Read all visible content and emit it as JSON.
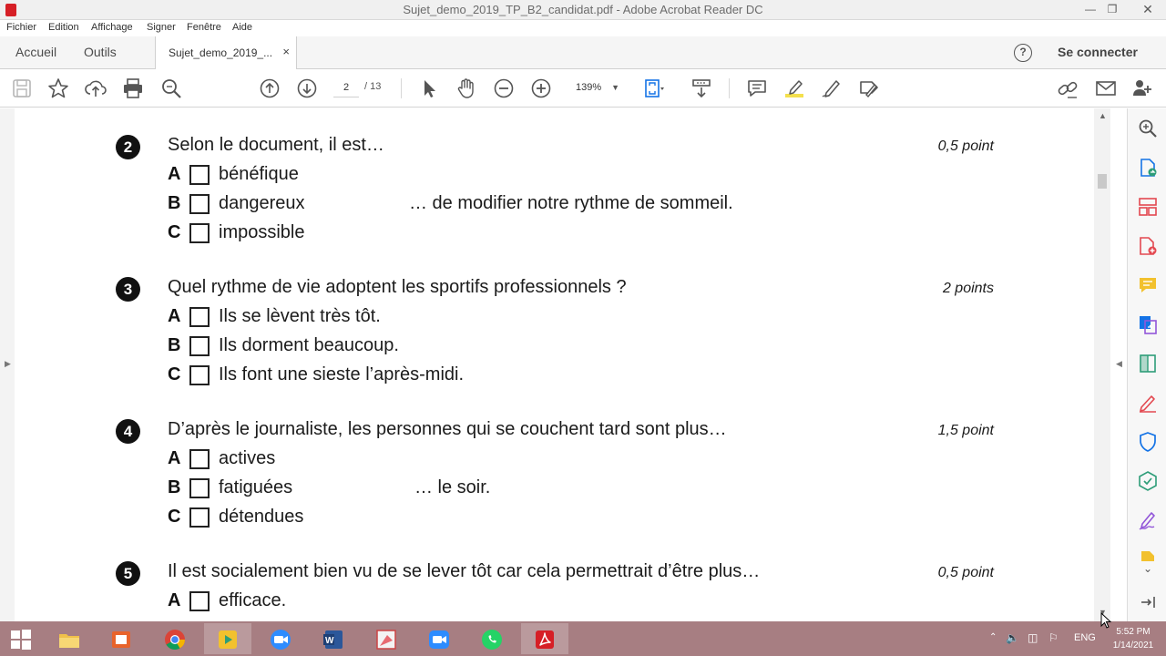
{
  "window": {
    "title": "Sujet_demo_2019_TP_B2_candidat.pdf - Adobe Acrobat Reader DC"
  },
  "menu": [
    "Fichier",
    "Edition",
    "Affichage",
    "Signer",
    "Fenêtre",
    "Aide"
  ],
  "tabs": {
    "home": "Accueil",
    "tools": "Outils",
    "document": "Sujet_demo_2019_...",
    "close": "×",
    "help": "?",
    "sign_in": "Se connecter"
  },
  "toolbar": {
    "current_page": "2",
    "total_pages": "/ 13",
    "zoom": "139%",
    "icons": [
      "save-icon",
      "star-icon",
      "cloud-upload-icon",
      "print-icon",
      "search-icon",
      "page-up-icon",
      "page-down-icon",
      "select-arrow-icon",
      "hand-icon",
      "zoom-out-icon",
      "zoom-in-icon",
      "fit-page-icon",
      "scroll-mode-icon",
      "comment-icon",
      "highlight-icon",
      "draw-icon",
      "fill-sign-icon",
      "link-icon",
      "mail-icon",
      "share-user-icon"
    ]
  },
  "document": {
    "questions": [
      {
        "number": "2",
        "text": "Selon le document, il est…",
        "points": "0,5 point",
        "options": [
          {
            "letter": "A",
            "text": "bénéfique"
          },
          {
            "letter": "B",
            "text": "dangereux"
          },
          {
            "letter": "C",
            "text": "impossible"
          }
        ],
        "suffix": "… de modifier notre rythme de sommeil."
      },
      {
        "number": "3",
        "text": "Quel rythme de vie adoptent les sportifs professionnels ?",
        "points": "2 points",
        "options": [
          {
            "letter": "A",
            "text": "Ils se lèvent très tôt."
          },
          {
            "letter": "B",
            "text": "Ils dorment beaucoup."
          },
          {
            "letter": "C",
            "text": "Ils font une sieste l’après-midi."
          }
        ]
      },
      {
        "number": "4",
        "text": "D’après le journaliste, les personnes qui se couchent tard sont plus…",
        "points": "1,5 point",
        "options": [
          {
            "letter": "A",
            "text": "actives"
          },
          {
            "letter": "B",
            "text": "fatiguées"
          },
          {
            "letter": "C",
            "text": "détendues"
          }
        ],
        "suffix": "… le soir."
      },
      {
        "number": "5",
        "text": "Il est socialement bien vu de se lever tôt car cela permettrait d’être plus…",
        "points": "0,5 point",
        "options": [
          {
            "letter": "A",
            "text": "efficace."
          }
        ]
      }
    ]
  },
  "right_panel": {
    "icons": [
      "zoom-search-icon",
      "export-pdf-icon",
      "organize-pages-icon",
      "create-pdf-icon",
      "comment-panel-icon",
      "combine-files-icon",
      "compress-icon",
      "edit-pdf-icon",
      "protect-icon",
      "send-for-review-icon",
      "fill-sign-panel-icon",
      "more-tools-icon",
      "scroll-down-icon",
      "collapse-panel-icon"
    ]
  },
  "taskbar": {
    "apps": [
      "start-icon",
      "file-explorer-icon",
      "office-app-icon",
      "chrome-icon",
      "media-player-icon",
      "zoom-app-icon",
      "word-icon",
      "paint-icon",
      "zoom-meetings-icon",
      "whatsapp-icon",
      "acrobat-icon"
    ],
    "language": "ENG",
    "time": "5:52 PM",
    "date": "1/14/2021"
  },
  "colors": {
    "acrobat_red": "#d61f26",
    "taskbar": "#a77e82",
    "highlight_yellow": "#f4e04d",
    "panel_blue": "#1473e6",
    "panel_pink": "#e34850",
    "panel_green": "#2d9d78",
    "panel_purple": "#9256d9"
  }
}
